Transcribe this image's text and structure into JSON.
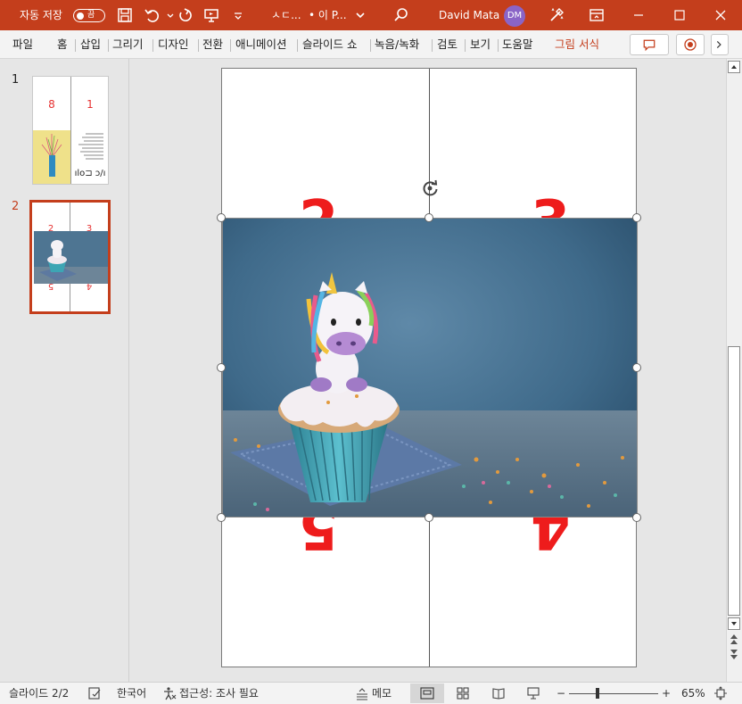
{
  "titlebar": {
    "autosave_label": "자동 저장",
    "autosave_state": "끔",
    "doc_title": "ㅅㄷ...",
    "doc_status": "• 이 P...",
    "user_name": "David Mata",
    "user_initials": "DM",
    "accent_color": "#c43e1c"
  },
  "ribbon": {
    "tabs": [
      "파일",
      "홈",
      "삽입",
      "그리기",
      "디자인",
      "전환",
      "애니메이션",
      "슬라이드 쇼",
      "녹음/녹화",
      "검토",
      "보기",
      "도움말",
      "그림 서식"
    ]
  },
  "thumbnails": [
    {
      "number": "1",
      "quadrants": [
        "8",
        "1"
      ],
      "bottom_text": "ılo⊐ ɔ/ı"
    },
    {
      "number": "2",
      "quadrants": [
        "2",
        "3",
        "5",
        "4"
      ]
    }
  ],
  "slide": {
    "top_left": "2",
    "top_right": "3",
    "bottom_left": "5",
    "bottom_right": "4"
  },
  "status": {
    "slide_indicator": "슬라이드 2/2",
    "language": "한국어",
    "accessibility": "접근성: 조사 필요",
    "notes": "메모",
    "zoom_minus": "−",
    "zoom_plus": "+",
    "zoom_percent": "65%"
  }
}
